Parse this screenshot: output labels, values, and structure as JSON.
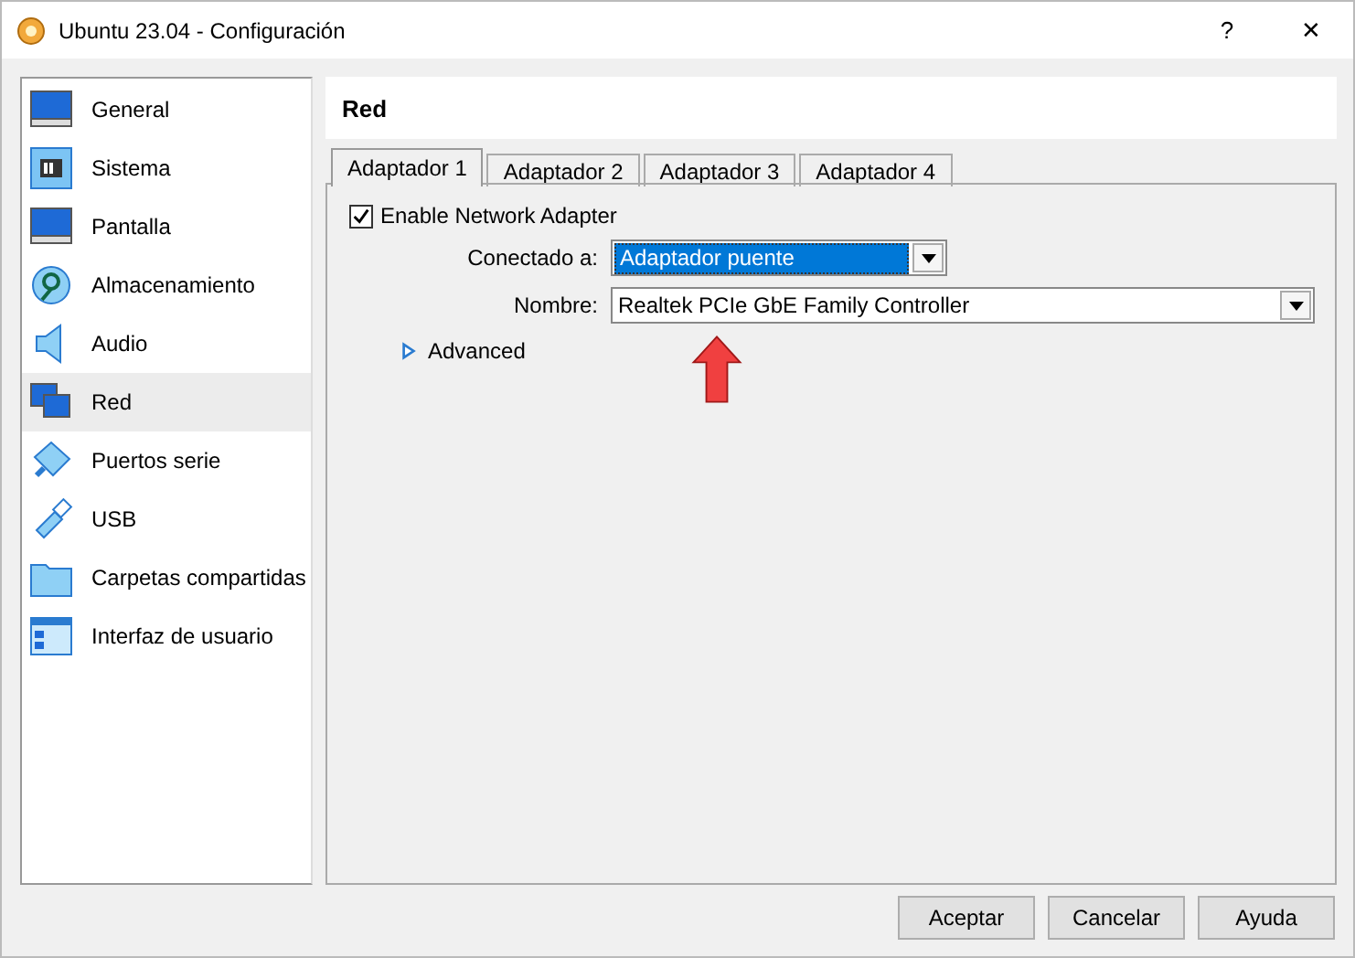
{
  "window": {
    "title": "Ubuntu 23.04 - Configuración",
    "help": "?",
    "close": "✕"
  },
  "sidebar": {
    "items": [
      {
        "label": "General",
        "selected": false
      },
      {
        "label": "Sistema",
        "selected": false
      },
      {
        "label": "Pantalla",
        "selected": false
      },
      {
        "label": "Almacenamiento",
        "selected": false
      },
      {
        "label": "Audio",
        "selected": false
      },
      {
        "label": "Red",
        "selected": true
      },
      {
        "label": "Puertos serie",
        "selected": false
      },
      {
        "label": "USB",
        "selected": false
      },
      {
        "label": "Carpetas compartidas",
        "selected": false
      },
      {
        "label": "Interfaz de usuario",
        "selected": false
      }
    ]
  },
  "page": {
    "title": "Red",
    "tabs": [
      {
        "label": "Adaptador 1",
        "selected": true
      },
      {
        "label": "Adaptador 2",
        "selected": false
      },
      {
        "label": "Adaptador 3",
        "selected": false
      },
      {
        "label": "Adaptador 4",
        "selected": false
      }
    ],
    "enable": {
      "label": "Enable Network Adapter",
      "checked": true
    },
    "fields": [
      {
        "label": "Conectado a:",
        "value": "Adaptador puente",
        "highlighted": true,
        "wide": false
      },
      {
        "label": "Nombre:",
        "value": "Realtek PCIe GbE Family Controller",
        "highlighted": false,
        "wide": true
      }
    ],
    "advanced": {
      "label": "Advanced",
      "expanded": false
    }
  },
  "buttons": [
    "Aceptar",
    "Cancelar",
    "Ayuda"
  ]
}
